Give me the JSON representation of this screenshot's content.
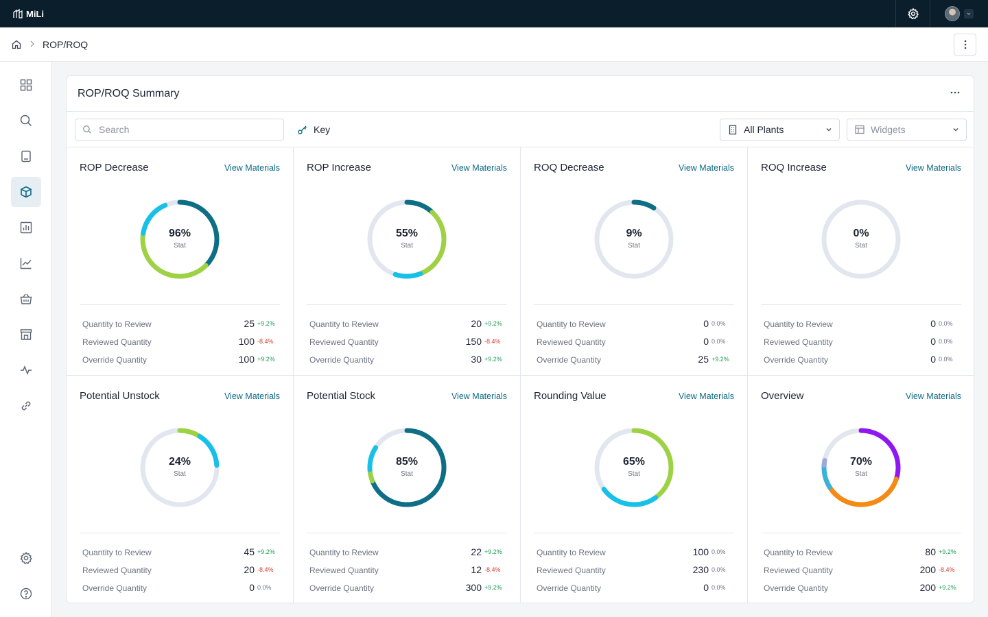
{
  "app": {
    "name": "MiLi"
  },
  "breadcrumb": {
    "current": "ROP/ROQ"
  },
  "panel": {
    "title": "ROP/ROQ Summary",
    "search_placeholder": "Search",
    "key_label": "Key",
    "plants_label": "All Plants",
    "widgets_label": "Widgets"
  },
  "cards": [
    {
      "title": "ROP Decrease",
      "link": "View Materials",
      "stat": "96%",
      "stat_label": "Stat",
      "segments": [
        {
          "color": "#0d6e85",
          "fraction": 0.375
        },
        {
          "color": "#9ed144",
          "fraction": 0.4
        },
        {
          "color": "#17c0e8",
          "fraction": 0.16
        }
      ],
      "rows": [
        {
          "label": "Quantity to Review",
          "value": "25",
          "delta": "+9.2%",
          "trend": "pos"
        },
        {
          "label": "Reviewed Quantity",
          "value": "100",
          "delta": "-8.4%",
          "trend": "neg"
        },
        {
          "label": "Override Quantity",
          "value": "100",
          "delta": "+9.2%",
          "trend": "pos"
        }
      ]
    },
    {
      "title": "ROP Increase",
      "link": "View Materials",
      "stat": "55%",
      "stat_label": "Stat",
      "segments": [
        {
          "color": "#0d6e85",
          "fraction": 0.12
        },
        {
          "color": "#9ed144",
          "fraction": 0.32
        },
        {
          "color": "#17c0e8",
          "fraction": 0.11
        }
      ],
      "rows": [
        {
          "label": "Quantity to Review",
          "value": "20",
          "delta": "+9.2%",
          "trend": "pos"
        },
        {
          "label": "Reviewed Quantity",
          "value": "150",
          "delta": "-8.4%",
          "trend": "neg"
        },
        {
          "label": "Override Quantity",
          "value": "30",
          "delta": "+9.2%",
          "trend": "pos"
        }
      ]
    },
    {
      "title": "ROQ Decrease",
      "link": "View Materials",
      "stat": "9%",
      "stat_label": "Stat",
      "segments": [
        {
          "color": "#0d6e85",
          "fraction": 0.09
        }
      ],
      "rows": [
        {
          "label": "Quantity to Review",
          "value": "0",
          "delta": "0.0%",
          "trend": "neu"
        },
        {
          "label": "Reviewed Quantity",
          "value": "0",
          "delta": "0.0%",
          "trend": "neu"
        },
        {
          "label": "Override Quantity",
          "value": "25",
          "delta": "+9.2%",
          "trend": "pos"
        }
      ]
    },
    {
      "title": "ROQ Increase",
      "link": "View Materials",
      "stat": "0%",
      "stat_label": "Stat",
      "segments": [],
      "rows": [
        {
          "label": "Quantity to Review",
          "value": "0",
          "delta": "0.0%",
          "trend": "neu"
        },
        {
          "label": "Reviewed Quantity",
          "value": "0",
          "delta": "0.0%",
          "trend": "neu"
        },
        {
          "label": "Override Quantity",
          "value": "0",
          "delta": "0.0%",
          "trend": "neu"
        }
      ]
    },
    {
      "title": "Potential Unstock",
      "link": "View Materials",
      "stat": "24%",
      "stat_label": "Stat",
      "segments": [
        {
          "color": "#9ed144",
          "fraction": 0.09
        },
        {
          "color": "#17c0e8",
          "fraction": 0.15
        }
      ],
      "rows": [
        {
          "label": "Quantity to Review",
          "value": "45",
          "delta": "+9.2%",
          "trend": "pos"
        },
        {
          "label": "Reviewed Quantity",
          "value": "20",
          "delta": "-8.4%",
          "trend": "neg"
        },
        {
          "label": "Override Quantity",
          "value": "0",
          "delta": "0.0%",
          "trend": "neu"
        }
      ]
    },
    {
      "title": "Potential Stock",
      "link": "View Materials",
      "stat": "85%",
      "stat_label": "Stat",
      "segments": [
        {
          "color": "#0d6e85",
          "fraction": 0.69
        },
        {
          "color": "#9ed144",
          "fraction": 0.05
        },
        {
          "color": "#17c0e8",
          "fraction": 0.1
        }
      ],
      "rows": [
        {
          "label": "Quantity to Review",
          "value": "22",
          "delta": "+9.2%",
          "trend": "pos"
        },
        {
          "label": "Reviewed Quantity",
          "value": "12",
          "delta": "-8.4%",
          "trend": "neg"
        },
        {
          "label": "Override Quantity",
          "value": "300",
          "delta": "+9.2%",
          "trend": "pos"
        }
      ]
    },
    {
      "title": "Rounding Value",
      "link": "View Materials",
      "stat": "65%",
      "stat_label": "Stat",
      "segments": [
        {
          "color": "#9ed144",
          "fraction": 0.4
        },
        {
          "color": "#17c0e8",
          "fraction": 0.25
        }
      ],
      "rows": [
        {
          "label": "Quantity to Review",
          "value": "100",
          "delta": "0.0%",
          "trend": "neu"
        },
        {
          "label": "Reviewed Quantity",
          "value": "230",
          "delta": "0.0%",
          "trend": "neu"
        },
        {
          "label": "Override Quantity",
          "value": "0",
          "delta": "0.0%",
          "trend": "neu"
        }
      ]
    },
    {
      "title": "Overview",
      "link": "View Materials",
      "stat": "70%",
      "stat_label": "Stat",
      "segments": [
        {
          "color": "#8f17f2",
          "fraction": 0.3
        },
        {
          "color": "#f58a14",
          "fraction": 0.36
        },
        {
          "color": "#3bb3d9",
          "fraction": 0.1
        },
        {
          "color": "#9ba9de",
          "fraction": 0.02
        }
      ],
      "rows": [
        {
          "label": "Quantity to Review",
          "value": "80",
          "delta": "+9.2%",
          "trend": "pos"
        },
        {
          "label": "Reviewed Quantity",
          "value": "200",
          "delta": "-8.4%",
          "trend": "neg"
        },
        {
          "label": "Override Quantity",
          "value": "200",
          "delta": "+9.2%",
          "trend": "pos"
        }
      ]
    }
  ],
  "colors": {
    "topbar": "#0b1e2b",
    "link": "#0e6a85",
    "track": "#e2e7ef",
    "positive": "#1f9d55",
    "negative": "#d13c2f"
  },
  "icons": {
    "sidebar": [
      "grid-icon",
      "search-icon",
      "book-icon",
      "box-icon",
      "bar-chart-icon",
      "line-chart-icon",
      "basket-icon",
      "store-icon",
      "activity-icon",
      "link-icon",
      "settings-icon",
      "help-icon"
    ]
  }
}
